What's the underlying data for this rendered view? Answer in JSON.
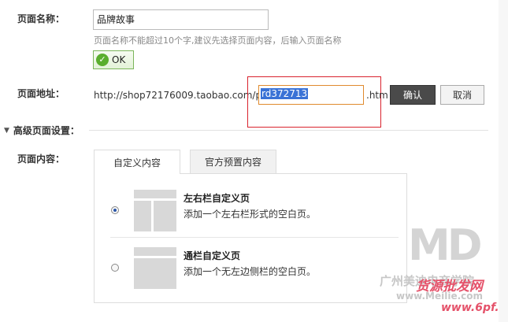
{
  "page_name": {
    "label": "页面名称：",
    "value": "品牌故事",
    "hint": "页面名称不能超过10个字,建议先选择页面内容，后输入页面名称",
    "ok_label": "OK"
  },
  "page_url": {
    "label": "页面地址：",
    "prefix": "http://shop72176009.taobao.com/p/",
    "value": "rd372713",
    "suffix": ".htm",
    "confirm_label": "确认",
    "cancel_label": "取消"
  },
  "advanced": {
    "toggle_label": "高级页面设置："
  },
  "content": {
    "label": "页面内容：",
    "tabs": [
      {
        "label": "自定义内容",
        "active": true
      },
      {
        "label": "官方预置内容",
        "active": false
      }
    ],
    "options": [
      {
        "title": "左右栏自定义页",
        "desc": "添加一个左右栏形式的空白页。",
        "selected": true
      },
      {
        "title": "通栏自定义页",
        "desc": "添加一个无左边侧栏的空白页。",
        "selected": false
      }
    ]
  },
  "watermarks": {
    "line1": "广州美迪电商学院",
    "line2": "www.Meilie.com",
    "line3": "货源批发网",
    "line4": "www.6pf.cn"
  },
  "colors": {
    "accent_red": "#d9232e",
    "ok_green": "#5aae2e",
    "selection_blue": "#3a72d6"
  }
}
